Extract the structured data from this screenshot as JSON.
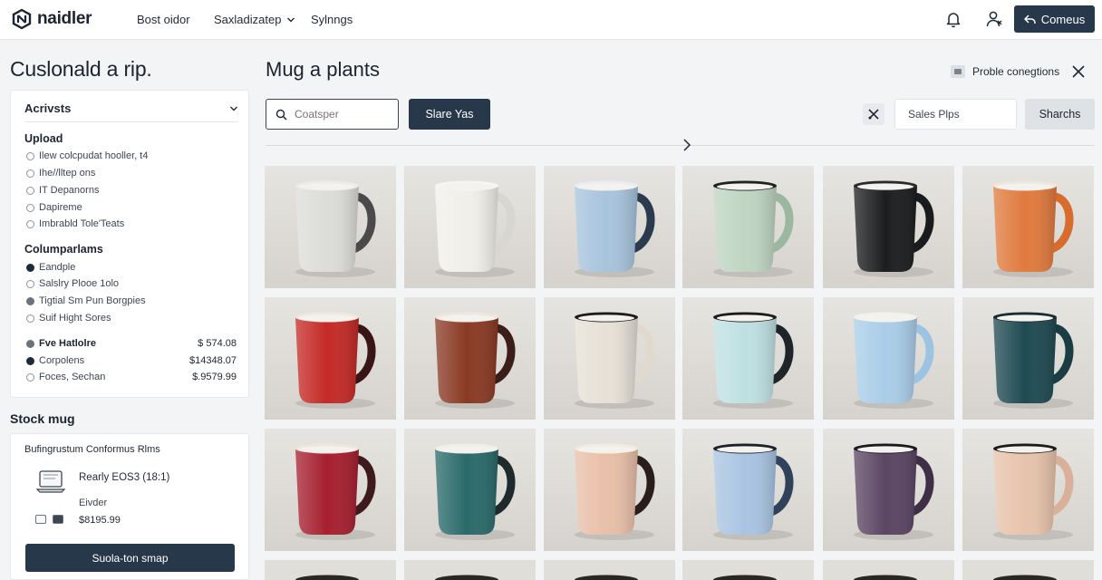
{
  "nav": {
    "brand": "naidler",
    "links": [
      "Bost oidor",
      "Saxladizatep",
      "Sylnngs"
    ],
    "cta": "Comeus",
    "icons": [
      "bell-icon",
      "user-icon",
      "share-icon"
    ]
  },
  "sidebar": {
    "heading": "Cuslonald a rip.",
    "filter_header": "Acrivsts",
    "upload": {
      "title": "Upload",
      "options": [
        "Ilew colcpudat hooller, t4",
        "Ihe//lltep ons",
        "IT Depanorns",
        "Dapireme",
        "Imbrabld Tole'Teats"
      ]
    },
    "columns": {
      "title": "Columparlams",
      "options": [
        {
          "label": "Eandple",
          "state": "filled"
        },
        {
          "label": "Salslry Plooe 1olo",
          "state": "empty"
        },
        {
          "label": "Tigtial Sm Pun Borgpies",
          "state": "grey"
        },
        {
          "label": "Suif Hight Sores",
          "state": "empty"
        }
      ]
    },
    "prices": [
      {
        "label": "Fve Hatlolre",
        "price": "$ 574.08",
        "state": "grey"
      },
      {
        "label": "Corpolens",
        "price": "$14348.07",
        "state": "filled"
      },
      {
        "label": "Foces, Sechan",
        "price": "$.9579.99",
        "state": "empty"
      }
    ],
    "stock": {
      "title": "Stock mug",
      "subtitle": "Bufingrustum Conformus Rlms",
      "item_name": "Rearly EOS3 (18:1)",
      "vendor": "Eivder",
      "price": "$8195.99",
      "button": "Suola-ton smap"
    }
  },
  "main": {
    "title": "Mug a plants",
    "top_right": "Proble conegtions",
    "search": {
      "placeholder": "Coatsper"
    },
    "search_button": "Slare Yas",
    "sales_placeholder": "Sales Plps",
    "grey_button": "Sharchs"
  },
  "mugs": [
    {
      "body": "#dcdcd9",
      "handle": "#4a4a4a",
      "rim": "#ebebe8"
    },
    {
      "body": "#f1efea",
      "handle": "#d8d6d1",
      "rim": "#f6f5f1"
    },
    {
      "body": "#a7c3dc",
      "handle": "#2c3a4e",
      "rim": "#e9edf1"
    },
    {
      "body": "#bfd5c2",
      "handle": "#9bb7a0",
      "rim": "#1d2321"
    },
    {
      "body": "#1c1d1f",
      "handle": "#1a1b1d",
      "rim": "#2a2b2e"
    },
    {
      "body": "#e07a3e",
      "handle": "#d76c2e",
      "rim": "#f1e6dc"
    },
    {
      "body": "#c42a26",
      "handle": "#3a1516",
      "rim": "#efe8e2"
    },
    {
      "body": "#8a3a24",
      "handle": "#3a1e17",
      "rim": "#efe6de"
    },
    {
      "body": "#e6e0d6",
      "handle": "#e0d9ce",
      "rim": "#1c1c1c"
    },
    {
      "body": "#bfe0e2",
      "handle": "#1e2428",
      "rim": "#1c1c1c"
    },
    {
      "body": "#a9cde8",
      "handle": "#9cc3e2",
      "rim": "#f3f1ec"
    },
    {
      "body": "#1f4a52",
      "handle": "#1a3c43",
      "rim": "#1c2b30"
    },
    {
      "body": "#a61f2f",
      "handle": "#3e1a1d",
      "rim": "#efe7de"
    },
    {
      "body": "#2a6a6a",
      "handle": "#1f2a2c",
      "rim": "#f2efe8"
    },
    {
      "body": "#e8bfa8",
      "handle": "#2a1e1b",
      "rim": "#f2ebe3"
    },
    {
      "body": "#a9c4e2",
      "handle": "#30415a",
      "rim": "#1c2028"
    },
    {
      "body": "#5b4563",
      "handle": "#3f2f46",
      "rim": "#1d1820"
    },
    {
      "body": "#e7c3ab",
      "handle": "#d9b19a",
      "rim": "#1e1a18"
    }
  ],
  "colors": {
    "primary": "#26384a",
    "page_bg": "#f3f4f5"
  }
}
